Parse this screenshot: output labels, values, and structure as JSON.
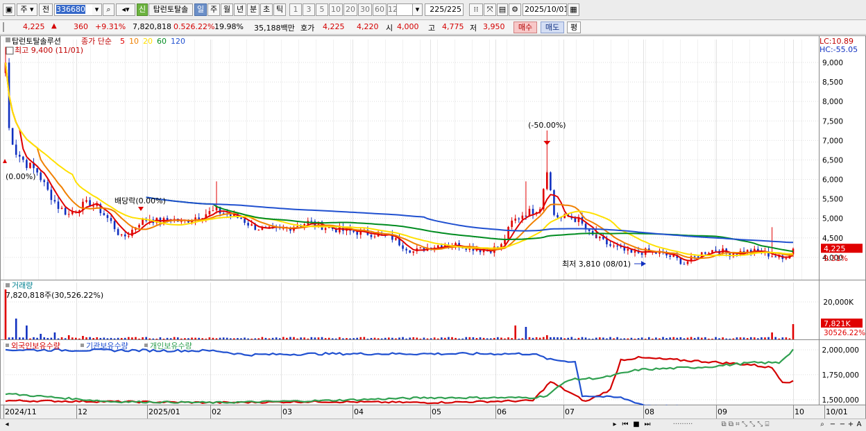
{
  "toolbar": {
    "period_select": "주",
    "prev_label": "전",
    "stock_code": "336680",
    "new_badge": "신",
    "stock_name": "탑런토탈솔",
    "periods": [
      "일",
      "주",
      "월",
      "년",
      "분",
      "초",
      "틱"
    ],
    "active_period": "일",
    "minute_steps": [
      "1",
      "3",
      "5",
      "10",
      "20",
      "30",
      "60",
      "120"
    ],
    "count": "225",
    "count_total": "/225",
    "date": "2025/10/01"
  },
  "quote": {
    "price": "4,225",
    "change_arrow": "▲",
    "change": "360",
    "change_pct": "+9.31%",
    "volume": "7,820,818",
    "volume_ratio": "0.526.22%",
    "turnover": "19.98%",
    "amount": "35,188백만",
    "hoga_label": "호가",
    "ask": "4,225",
    "bid": "4,220",
    "open_label": "시",
    "open": "4,000",
    "high_label": "고",
    "high": "4,775",
    "low_label": "저",
    "low": "3,950",
    "buy_label": "매수",
    "sell_label": "매도",
    "avg_label": "평"
  },
  "price_panel": {
    "title": "탑런토탈솔루션",
    "ma_label": "종가 단순",
    "ma_periods": [
      "5",
      "10",
      "20",
      "60",
      "120"
    ],
    "ma_colors": [
      "#e00000",
      "#f08000",
      "#ffe000",
      "#008c20",
      "#2050d0"
    ],
    "high_note": "최고 9,400 (11/01)",
    "low_note": "최저 3,810 (08/01)",
    "lc": "LC:10.89",
    "hc": "HC:-55.05",
    "price_badge": "4,225",
    "pct_badge": "9.31%",
    "annotation_split": "(-50.00%)",
    "annotation_dividend": "배당락(0.00%)",
    "annotation_left": "(0.00%)",
    "y_ticks": [
      "9,000",
      "8,500",
      "8,000",
      "7,500",
      "7,000",
      "6,500",
      "6,000",
      "5,500",
      "5,000",
      "4,500",
      "4,000"
    ]
  },
  "volume_panel": {
    "title": "거래량",
    "info": "7,820,818주(30,526.22%)",
    "y_tick": "20,000K",
    "badge": "7,821K",
    "badge2": "30526.22%"
  },
  "holding_panel": {
    "legend": [
      "외국인보유수량",
      "기관보유수량",
      "개인보유수량"
    ],
    "colors": [
      "#d40000",
      "#2050d0",
      "#30a050"
    ],
    "y_ticks": [
      "2,000,000",
      "1,750,000",
      "1,500,000"
    ]
  },
  "x_axis": {
    "labels": [
      "2024/11",
      "12",
      "2025/01",
      "02",
      "03",
      "04",
      "05",
      "06",
      "07",
      "08",
      "09",
      "10",
      "10/01"
    ]
  }
}
